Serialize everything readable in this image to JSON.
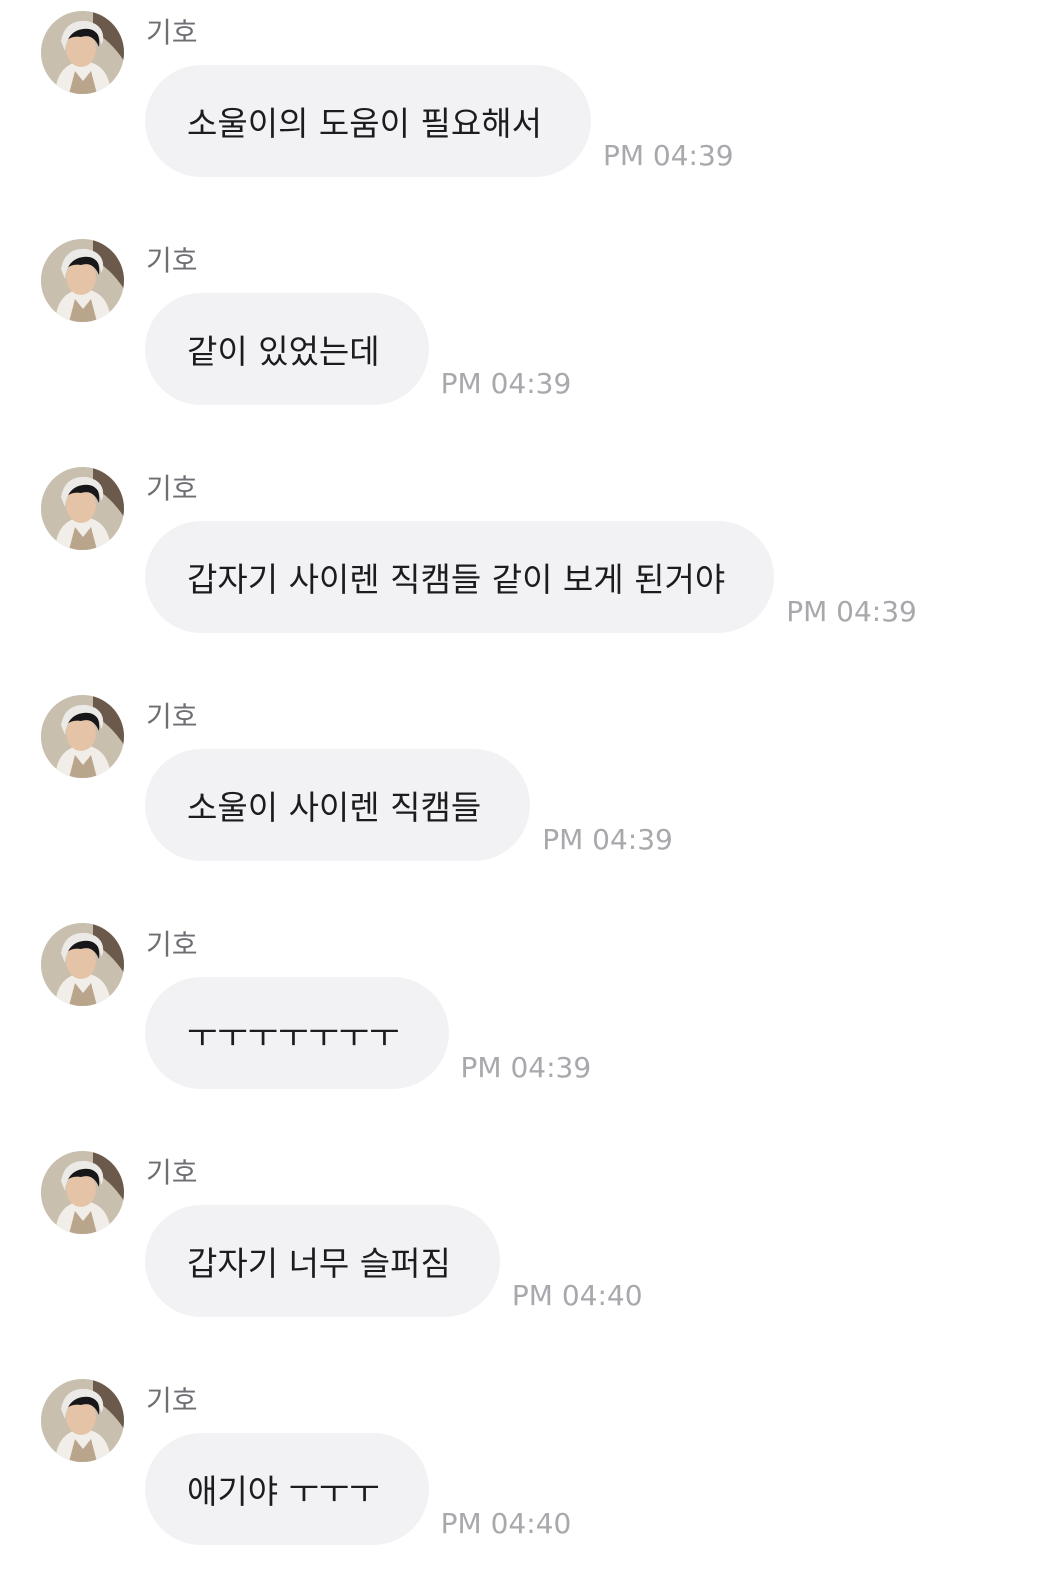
{
  "messages": [
    {
      "sender": "기호",
      "text": "소울이의 도움이 필요해서",
      "time": "PM 04:39"
    },
    {
      "sender": "기호",
      "text": "같이 있었는데",
      "time": "PM 04:39"
    },
    {
      "sender": "기호",
      "text": "갑자기 사이렌 직캠들 같이 보게 된거야",
      "time": "PM 04:39"
    },
    {
      "sender": "기호",
      "text": "소울이 사이렌 직캠들",
      "time": "PM 04:39"
    },
    {
      "sender": "기호",
      "text": "ㅜㅜㅜㅜㅜㅜㅜ",
      "time": "PM 04:39"
    },
    {
      "sender": "기호",
      "text": "갑자기 너무 슬퍼짐",
      "time": "PM 04:40"
    },
    {
      "sender": "기호",
      "text": "애기야 ㅜㅜㅜ",
      "time": "PM 04:40"
    }
  ],
  "colors": {
    "bubble": "#f2f2f4",
    "text": "#1c1c1e",
    "sender": "#6e6e73",
    "time": "#a8a8ad",
    "background": "#ffffff"
  },
  "icons": {
    "avatar": "profile-photo"
  }
}
